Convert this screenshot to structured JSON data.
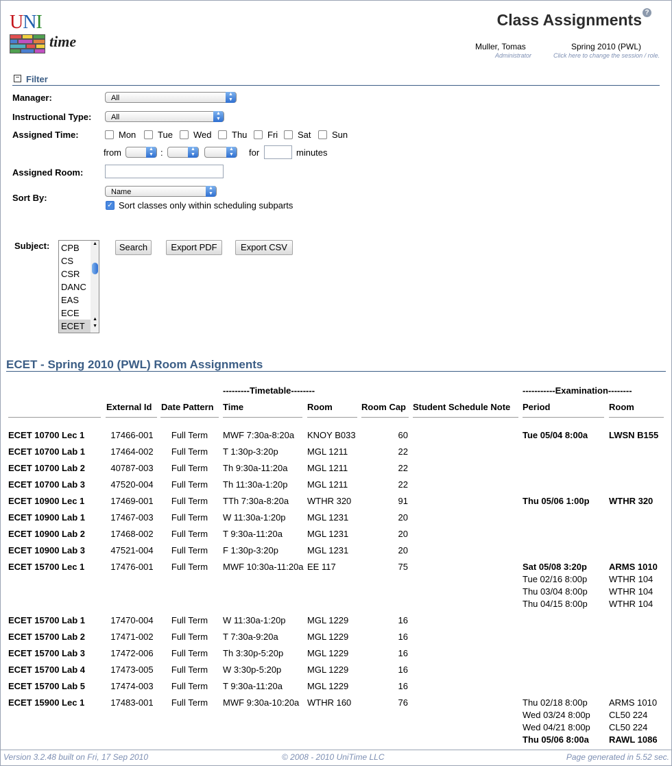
{
  "header": {
    "logo_uni": [
      "U",
      "N",
      "I"
    ],
    "logo_time": "time",
    "page_title": "Class Assignments",
    "help_icon": "help-icon",
    "user_name": "Muller, Tomas",
    "user_role": "Administrator",
    "session": "Spring 2010 (PWL)",
    "session_hint": "Click here to change the session / role."
  },
  "filter": {
    "title": "Filter",
    "manager_label": "Manager:",
    "manager_value": "All",
    "itype_label": "Instructional Type:",
    "itype_value": "All",
    "assigned_time_label": "Assigned Time:",
    "days": [
      "Mon",
      "Tue",
      "Wed",
      "Thu",
      "Fri",
      "Sat",
      "Sun"
    ],
    "from_label": "from",
    "colon": ":",
    "for_label": "for",
    "minutes_label": "minutes",
    "assigned_room_label": "Assigned Room:",
    "assigned_room_value": "",
    "sort_by_label": "Sort By:",
    "sort_by_value": "Name",
    "sort_subparts_label": "Sort classes only within scheduling subparts",
    "sort_subparts_checked": true,
    "subject_label": "Subject:",
    "subjects": [
      "CPB",
      "CS",
      "CSR",
      "DANC",
      "EAS",
      "ECE",
      "ECET"
    ],
    "selected_subject": "ECET",
    "search_button": "Search",
    "export_pdf_button": "Export PDF",
    "export_csv_button": "Export CSV"
  },
  "results": {
    "title": "ECET - Spring 2010 (PWL) Room Assignments",
    "group_timetable": "---------Timetable--------",
    "group_exam": "-----------Examination--------",
    "columns": [
      "External Id",
      "Date Pattern",
      "Time",
      "Room",
      "Room Cap",
      "Student Schedule Note",
      "Period",
      "Room"
    ],
    "rows": [
      {
        "name": "ECET 10700 Lec 1",
        "ext": "17466-001",
        "pattern": "Full Term",
        "time": "MWF 7:30a-8:20a",
        "room": "KNOY B033",
        "cap": "60",
        "exams": [
          {
            "period": "Tue 05/04 8:00a",
            "room": "LWSN B155",
            "bold": true
          }
        ]
      },
      {
        "name": "ECET 10700 Lab 1",
        "ext": "17464-002",
        "pattern": "Full Term",
        "time": "T 1:30p-3:20p",
        "room": "MGL 1211",
        "cap": "22",
        "exams": []
      },
      {
        "name": "ECET 10700 Lab 2",
        "ext": "40787-003",
        "pattern": "Full Term",
        "time": "Th 9:30a-11:20a",
        "room": "MGL 1211",
        "cap": "22",
        "exams": []
      },
      {
        "name": "ECET 10700 Lab 3",
        "ext": "47520-004",
        "pattern": "Full Term",
        "time": "Th 11:30a-1:20p",
        "room": "MGL 1211",
        "cap": "22",
        "exams": []
      },
      {
        "name": "ECET 10900 Lec 1",
        "ext": "17469-001",
        "pattern": "Full Term",
        "time": "TTh 7:30a-8:20a",
        "room": "WTHR 320",
        "cap": "91",
        "exams": [
          {
            "period": "Thu 05/06 1:00p",
            "room": "WTHR 320",
            "bold": true
          }
        ]
      },
      {
        "name": "ECET 10900 Lab 1",
        "ext": "17467-003",
        "pattern": "Full Term",
        "time": "W 11:30a-1:20p",
        "room": "MGL 1231",
        "cap": "20",
        "exams": []
      },
      {
        "name": "ECET 10900 Lab 2",
        "ext": "17468-002",
        "pattern": "Full Term",
        "time": "T 9:30a-11:20a",
        "room": "MGL 1231",
        "cap": "20",
        "exams": []
      },
      {
        "name": "ECET 10900 Lab 3",
        "ext": "47521-004",
        "pattern": "Full Term",
        "time": "F 1:30p-3:20p",
        "room": "MGL 1231",
        "cap": "20",
        "exams": []
      },
      {
        "name": "ECET 15700 Lec 1",
        "ext": "17476-001",
        "pattern": "Full Term",
        "time": "MWF 10:30a-11:20a",
        "room": "EE 117",
        "cap": "75",
        "exams": [
          {
            "period": "Sat 05/08 3:20p",
            "room": "ARMS 1010",
            "bold": true
          },
          {
            "period": "Tue 02/16 8:00p",
            "room": "WTHR 104",
            "bold": false
          },
          {
            "period": "Thu 03/04 8:00p",
            "room": "WTHR 104",
            "bold": false
          },
          {
            "period": "Thu 04/15 8:00p",
            "room": "WTHR 104",
            "bold": false
          }
        ]
      },
      {
        "name": "ECET 15700 Lab 1",
        "ext": "17470-004",
        "pattern": "Full Term",
        "time": "W 11:30a-1:20p",
        "room": "MGL 1229",
        "cap": "16",
        "exams": []
      },
      {
        "name": "ECET 15700 Lab 2",
        "ext": "17471-002",
        "pattern": "Full Term",
        "time": "T 7:30a-9:20a",
        "room": "MGL 1229",
        "cap": "16",
        "exams": []
      },
      {
        "name": "ECET 15700 Lab 3",
        "ext": "17472-006",
        "pattern": "Full Term",
        "time": "Th 3:30p-5:20p",
        "room": "MGL 1229",
        "cap": "16",
        "exams": []
      },
      {
        "name": "ECET 15700 Lab 4",
        "ext": "17473-005",
        "pattern": "Full Term",
        "time": "W 3:30p-5:20p",
        "room": "MGL 1229",
        "cap": "16",
        "exams": []
      },
      {
        "name": "ECET 15700 Lab 5",
        "ext": "17474-003",
        "pattern": "Full Term",
        "time": "T 9:30a-11:20a",
        "room": "MGL 1229",
        "cap": "16",
        "exams": []
      },
      {
        "name": "ECET 15900 Lec 1",
        "ext": "17483-001",
        "pattern": "Full Term",
        "time": "MWF 9:30a-10:20a",
        "room": "WTHR 160",
        "cap": "76",
        "exams": [
          {
            "period": "Thu 02/18 8:00p",
            "room": "ARMS 1010",
            "bold": false
          },
          {
            "period": "Wed 03/24 8:00p",
            "room": "CL50 224",
            "bold": false
          },
          {
            "period": "Wed 04/21 8:00p",
            "room": "CL50 224",
            "bold": false
          },
          {
            "period": "Thu 05/06 8:00a",
            "room": "RAWL 1086",
            "bold": true
          }
        ]
      }
    ]
  },
  "footer": {
    "version": "Version 3.2.48 built on Fri, 17 Sep 2010",
    "copyright": "© 2008 - 2010 UniTime LLC",
    "generated": "Page generated in 5.52 sec."
  },
  "colors": {
    "accent": "#3b5d85",
    "hint": "#7d8fb3",
    "select_arrow": "#2f6fd0"
  }
}
